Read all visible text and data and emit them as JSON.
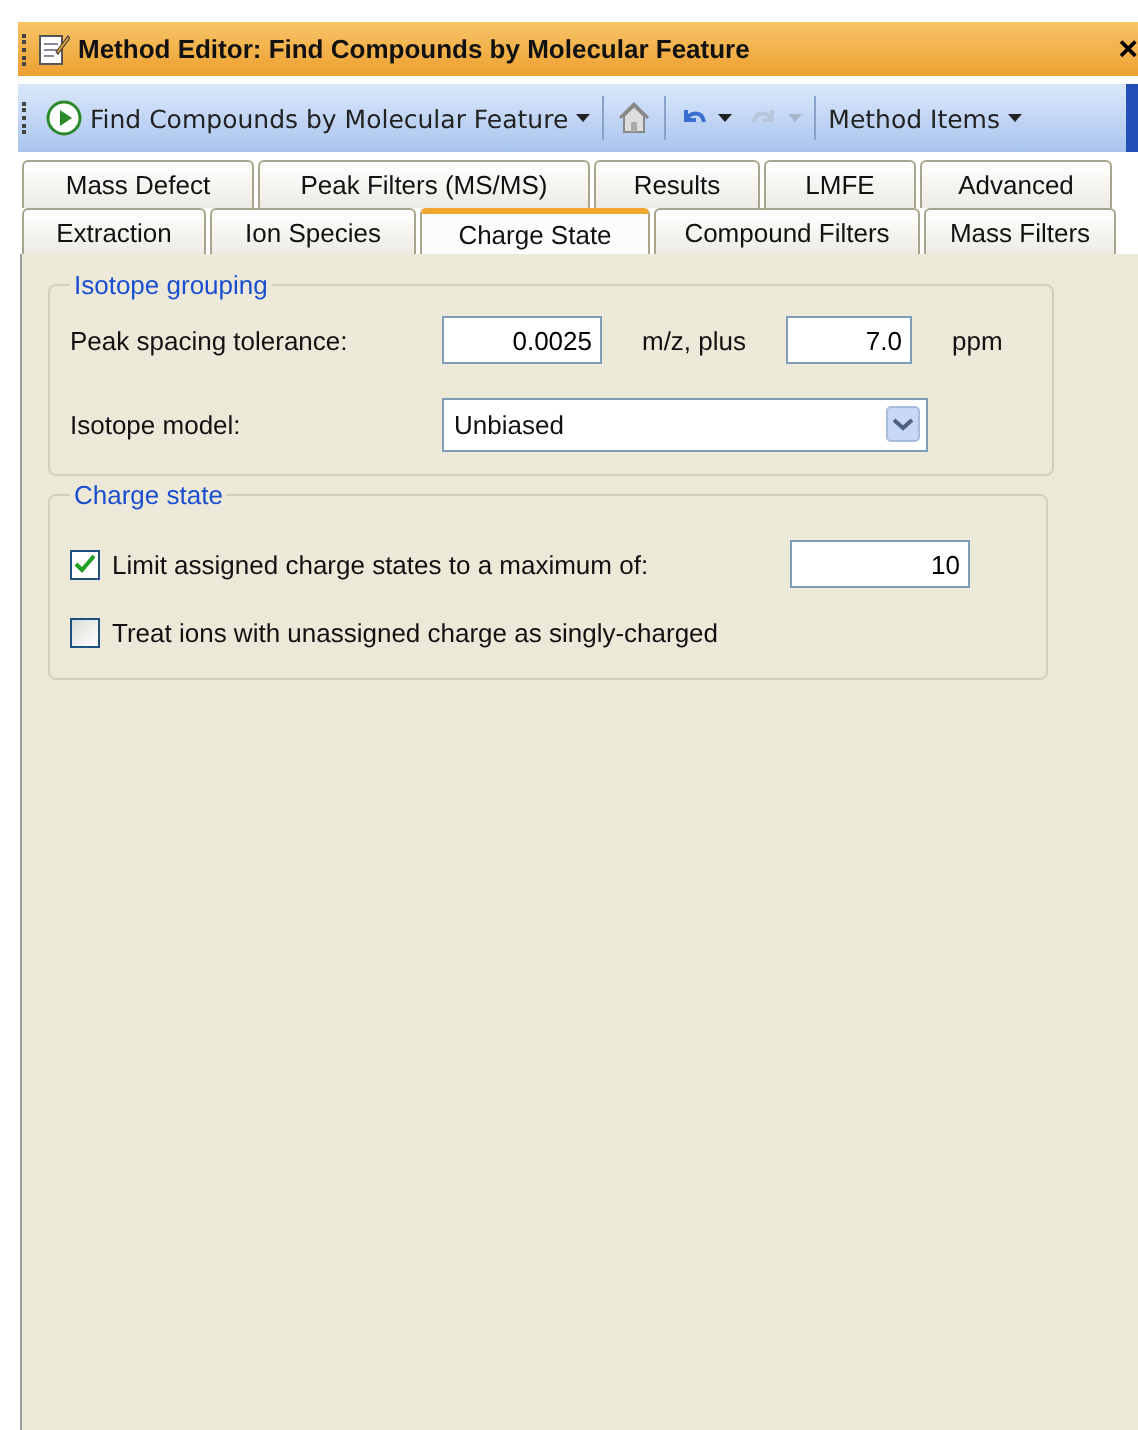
{
  "window": {
    "title": "Method Editor: Find Compounds by Molecular Feature",
    "close": "×"
  },
  "toolbar": {
    "method": "Find Compounds by Molecular Feature",
    "history": [
      {
        "kind": "undo",
        "disabled": false
      },
      {
        "kind": "redo",
        "disabled": true
      }
    ],
    "menu": "Method Items"
  },
  "tab_rows": [
    {
      "tabs": [
        {
          "label": "Mass Defect",
          "selected": false
        },
        {
          "label": "Peak Filters (MS/MS)",
          "selected": false
        },
        {
          "label": "Results",
          "selected": false
        },
        {
          "label": "LMFE",
          "selected": false
        },
        {
          "label": "Advanced",
          "selected": false
        }
      ]
    },
    {
      "tabs": [
        {
          "label": "Extraction",
          "selected": false
        },
        {
          "label": "Ion Species",
          "selected": false
        },
        {
          "label": "Charge State",
          "selected": true
        },
        {
          "label": "Compound Filters",
          "selected": false
        },
        {
          "label": "Mass Filters",
          "selected": false
        }
      ]
    }
  ],
  "isotope_grouping": {
    "title": "Isotope grouping",
    "tolerance_label": "Peak spacing tolerance:",
    "tolerance_mz": "0.0025",
    "mz_unit": "m/z, plus",
    "tolerance_ppm": "7.0",
    "ppm_unit": "ppm",
    "model_label": "Isotope model:",
    "model": "Unbiased"
  },
  "charge_state": {
    "title": "Charge state",
    "options": [
      {
        "label": "Limit assigned charge states to a maximum of:",
        "checked": true,
        "value": "10"
      },
      {
        "label": "Treat ions with unassigned charge as singly-charged",
        "checked": false
      }
    ]
  }
}
